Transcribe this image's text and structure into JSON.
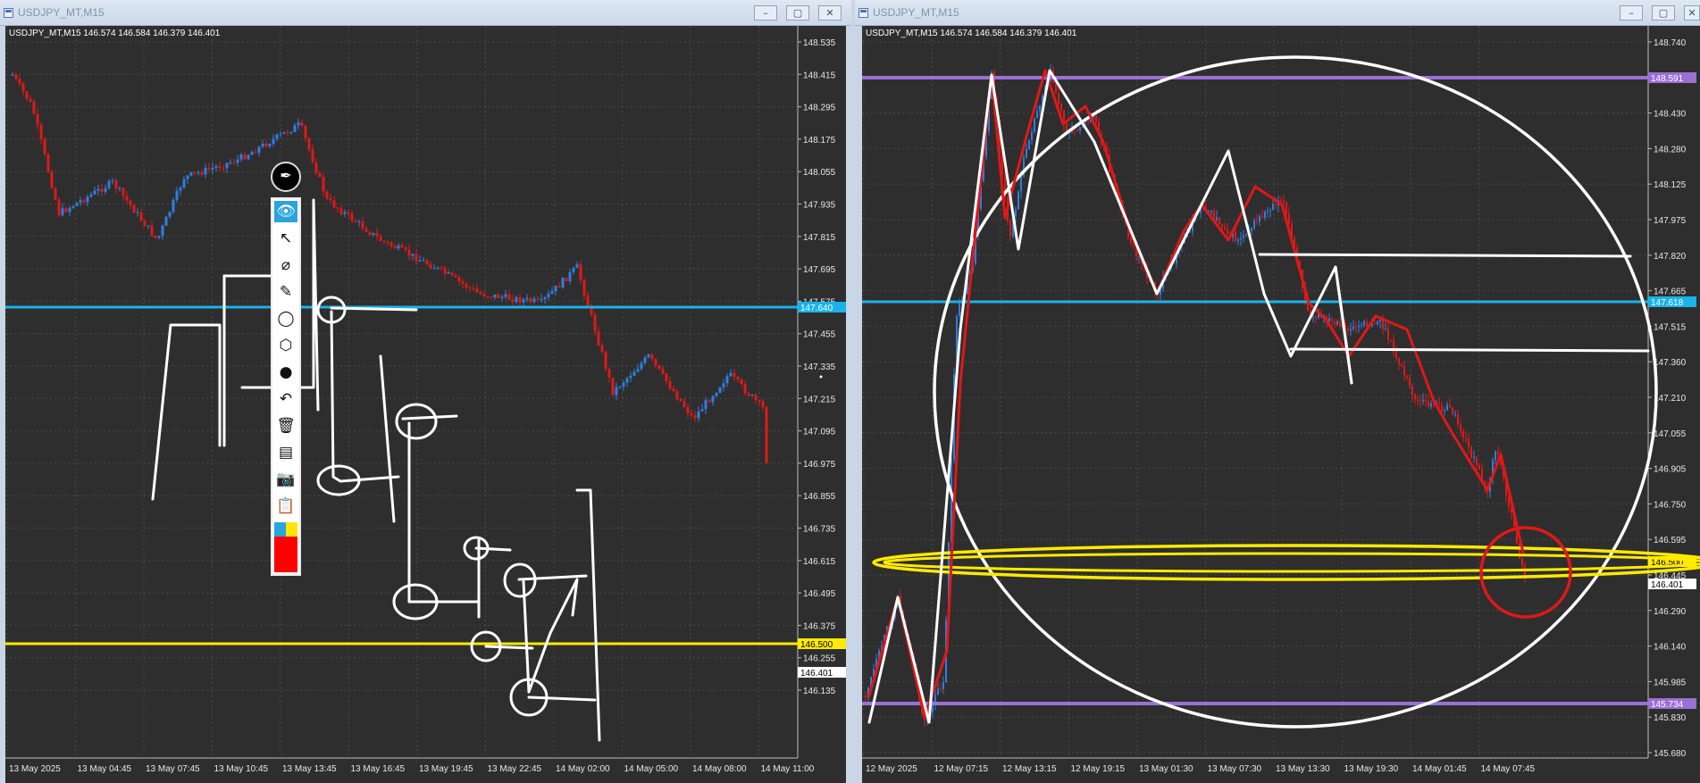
{
  "left": {
    "title": "USDJPY_MT,M15",
    "info": "USDJPY_MT,M15  146.574 146.584 146.379 146.401",
    "prices": [
      "148.535",
      "148.415",
      "148.295",
      "148.175",
      "148.055",
      "147.935",
      "147.815",
      "147.695",
      "147.575",
      "147.455",
      "147.335",
      "147.215",
      "147.095",
      "146.975",
      "146.855",
      "146.735",
      "146.615",
      "146.495",
      "146.375",
      "146.255",
      "146.135"
    ],
    "times": [
      "13 May 2025",
      "13 May 04:45",
      "13 May 07:45",
      "13 May 10:45",
      "13 May 13:45",
      "13 May 16:45",
      "13 May 19:45",
      "13 May 22:45",
      "14 May 02:00",
      "14 May 05:00",
      "14 May 08:00",
      "14 May 11:00"
    ],
    "hline_blue": "147.640",
    "hline_yellow": "146.500",
    "bid_tag": "146.401"
  },
  "right": {
    "title": "USDJPY_MT,M15",
    "info": "USDJPY_MT,M15  146.574 146.584 146.379 146.401",
    "prices": [
      "148.740",
      "148.585",
      "148.430",
      "148.280",
      "148.125",
      "147.975",
      "147.820",
      "147.665",
      "147.515",
      "147.360",
      "147.210",
      "147.055",
      "146.905",
      "146.750",
      "146.595",
      "146.445",
      "146.290",
      "146.140",
      "145.985",
      "145.830",
      "145.680"
    ],
    "times": [
      "12 May 2025",
      "12 May 07:15",
      "12 May 13:15",
      "12 May 19:15",
      "13 May 01:30",
      "13 May 07:30",
      "13 May 13:30",
      "13 May 19:30",
      "14 May 01:45",
      "14 May 07:45"
    ],
    "hline_purple_top": "148.591",
    "hline_blue": "147.618",
    "hline_yellow": "146.500",
    "bid_tag": "146.401",
    "hline_purple_bottom": "145.734"
  },
  "window_controls": {
    "minimize": "–",
    "maximize": "▢",
    "close": "✕"
  },
  "toolbar": {
    "icons": [
      "pen-icon",
      "eye-icon",
      "cursor-icon",
      "eraser-icon",
      "highlighter-icon",
      "circle-icon",
      "ruler-icon",
      "dot-icon",
      "undo-icon",
      "trash-icon",
      "screen-icon",
      "camera-icon",
      "clipboard-icon"
    ],
    "colors": {
      "blue": "#2aa4db",
      "yellow": "#ffe600",
      "red": "#ff0000"
    }
  },
  "colors": {
    "chart_bg": "#2e2e2e",
    "grid": "#4a4a4a",
    "bull": "#2f7de1",
    "bear": "#e01818",
    "blue_line": "#19b3ea",
    "yellow_line": "#ffea00",
    "purple_line": "#9b70d6",
    "drawing": "#ffffff",
    "axis_text": "#e8e8e8"
  }
}
